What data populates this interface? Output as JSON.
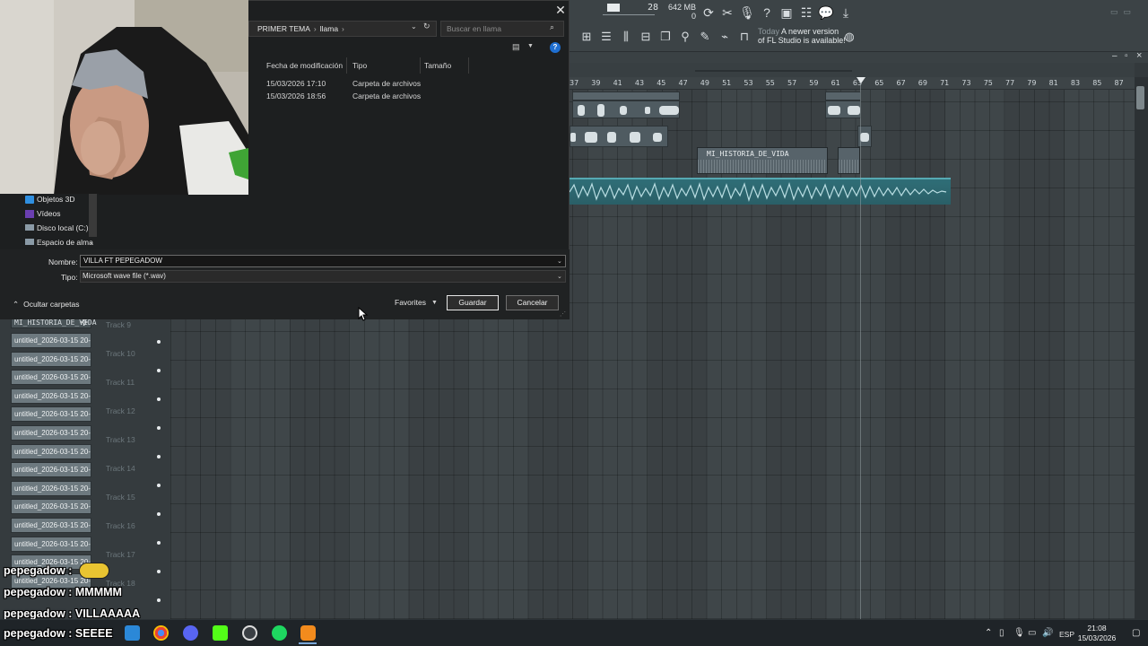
{
  "fl": {
    "tempo_small": "28",
    "memory": "642 MB",
    "mem_count": "0",
    "update_label": "Today",
    "update_msg": "A newer version of FL Studio is available!",
    "ruler": [
      "37",
      "39",
      "41",
      "43",
      "45",
      "47",
      "49",
      "51",
      "53",
      "55",
      "57",
      "59",
      "61",
      "63",
      "65",
      "67",
      "69",
      "71",
      "73",
      "75",
      "77",
      "79",
      "81",
      "83",
      "85",
      "87"
    ],
    "clip_pattern": "MI_HISTORIA_DE_VIDA",
    "tracks": [
      "Track 9",
      "Track 10",
      "Track 11",
      "Track 12",
      "Track 13",
      "Track 14",
      "Track 15",
      "Track 16",
      "Track 17",
      "Track 18"
    ],
    "left_clips": [
      "untitled_2026-03-15 20-...",
      "untitled_2026-03-15 20-...",
      "untitled_2026-03-15 20-...",
      "untitled_2026-03-15 20-...",
      "untitled_2026-03-15 20-...",
      "untitled_2026-03-15 20-...",
      "untitled_2026-03-15 20-...",
      "untitled_2026-03-15 20-...",
      "untitled_2026-03-15 20-...",
      "untitled_2026-03-15 20-...",
      "untitled_2026-03-15 20-...",
      "untitled_2026-03-15 20-...",
      "untitled_2026-03-15 20-...",
      "untitled_2026-03-15 20-..."
    ]
  },
  "dialog": {
    "breadcrumb": [
      "PRIMER TEMA",
      "llama"
    ],
    "search_placeholder": "Buscar en llama",
    "columns": [
      "Fecha de modificación",
      "Tipo",
      "Tamaño"
    ],
    "rows": [
      {
        "date": "15/03/2026 17:10",
        "type": "Carpeta de archivos"
      },
      {
        "date": "15/03/2026 18:56",
        "type": "Carpeta de archivos"
      }
    ],
    "nav": [
      "Objetos 3D",
      "Vídeos",
      "Disco local (C:)",
      "Espacio de alma"
    ],
    "name_label": "Nombre:",
    "name_value": "VILLA FT PEPEGADOW",
    "type_label": "Tipo:",
    "type_value": "Microsoft wave file (*.wav)",
    "hide_folders": "Ocultar carpetas",
    "favorites": "Favorites",
    "save": "Guardar",
    "cancel": "Cancelar"
  },
  "chat": [
    {
      "user": "pepegadow",
      "msg": ":"
    },
    {
      "user": "pepegadow",
      "msg": ": MMMMM"
    },
    {
      "user": "pepegadow",
      "msg": ": VILLAAAAA"
    },
    {
      "user": "pepegadow",
      "msg": ": SEEEE"
    }
  ],
  "taskbar": {
    "lang": "ESP",
    "time": "21:08",
    "date": "15/03/2026"
  },
  "colors": {
    "accent": "#1f6fd1",
    "wave": "#3a7c86",
    "chat_user": "#9be84a"
  }
}
